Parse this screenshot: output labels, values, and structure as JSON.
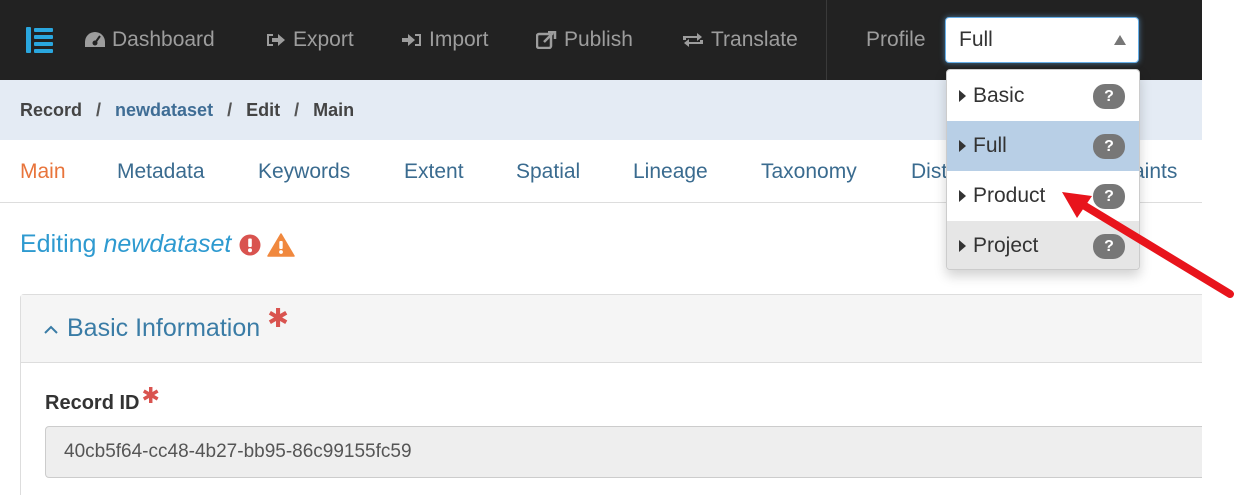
{
  "navbar": {
    "items": [
      {
        "label": "Dashboard",
        "icon": "dashboard-icon"
      },
      {
        "label": "Export",
        "icon": "export-icon"
      },
      {
        "label": "Import",
        "icon": "import-icon"
      },
      {
        "label": "Publish",
        "icon": "publish-icon"
      },
      {
        "label": "Translate",
        "icon": "translate-icon"
      }
    ],
    "profile_label": "Profile",
    "profile_value": "Full"
  },
  "profile_menu": {
    "options": [
      {
        "label": "Basic",
        "help": "?"
      },
      {
        "label": "Full",
        "help": "?"
      },
      {
        "label": "Product",
        "help": "?"
      },
      {
        "label": "Project",
        "help": "?"
      }
    ],
    "selected": "Full",
    "hovered": "Product"
  },
  "breadcrumb": {
    "items": [
      "Record",
      "newdataset",
      "Edit",
      "Main"
    ],
    "separator": "/"
  },
  "tabs": [
    "Main",
    "Metadata",
    "Keywords",
    "Extent",
    "Spatial",
    "Lineage",
    "Taxonomy",
    "Dist",
    "aints"
  ],
  "active_tab": "Main",
  "editing": {
    "prefix": "Editing",
    "name": "newdataset"
  },
  "panel": {
    "title": "Basic Information",
    "required_mark": "✱"
  },
  "record_id": {
    "label": "Record ID",
    "required_mark": "✱",
    "value": "40cb5f64-cc48-4b27-bb95-86c99155fc59"
  },
  "colors": {
    "navbar_bg": "#222222",
    "nav_text": "#9d9d9d",
    "link": "#3a6b8f",
    "active_tab": "#e8743b",
    "title": "#2e9ad0",
    "error_icon": "#d9534f",
    "warning_icon": "#f0883e",
    "arrow": "#e8141c"
  }
}
